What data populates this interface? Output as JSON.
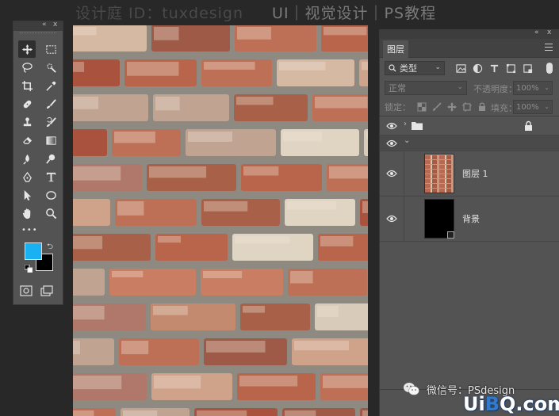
{
  "header": {
    "designer": "设计庭 ID：tuxdesign",
    "title": "UI｜视觉设计｜PS教程"
  },
  "tools": {
    "collapse": "«",
    "close": "x",
    "more": "•••",
    "foreground_color": "#19b1f2",
    "background_color": "#000000",
    "items": [
      {
        "name": "move-tool-icon",
        "active": true
      },
      {
        "name": "marquee-tool-icon"
      },
      {
        "name": "lasso-tool-icon"
      },
      {
        "name": "quick-select-tool-icon"
      },
      {
        "name": "crop-tool-icon"
      },
      {
        "name": "eyedropper-tool-icon"
      },
      {
        "name": "healing-brush-tool-icon"
      },
      {
        "name": "brush-tool-icon"
      },
      {
        "name": "clone-stamp-tool-icon"
      },
      {
        "name": "history-brush-tool-icon"
      },
      {
        "name": "eraser-tool-icon"
      },
      {
        "name": "gradient-tool-icon"
      },
      {
        "name": "blur-tool-icon"
      },
      {
        "name": "dodge-tool-icon"
      },
      {
        "name": "pen-tool-icon"
      },
      {
        "name": "type-tool-icon"
      },
      {
        "name": "path-select-tool-icon"
      },
      {
        "name": "ellipse-tool-icon"
      },
      {
        "name": "hand-tool-icon"
      },
      {
        "name": "zoom-tool-icon"
      }
    ]
  },
  "layers_panel": {
    "collapse": "«",
    "close": "x",
    "tab": "图层",
    "filter_kind": "类型",
    "blend_mode": "正常",
    "opacity_label": "不透明度：",
    "opacity_value": "100%",
    "lock_label": "锁定：",
    "fill_label": "填充：",
    "fill_value": "100%",
    "layers": [
      {
        "kind": "group",
        "name": "",
        "collapsed": true,
        "locked": true
      },
      {
        "kind": "group-open",
        "name": ""
      },
      {
        "kind": "layer",
        "name": "图层 1",
        "thumb": "bricks"
      },
      {
        "kind": "layer",
        "name": "背景",
        "thumb": "black"
      }
    ]
  },
  "watermarks": {
    "wechat": "微信号：PSdesign",
    "site_prefix": "Ui",
    "site_b": "B",
    "site_suffix": "Q.com"
  },
  "colors": {
    "app_bg": "#282828",
    "panel_bg": "#535353",
    "accent_blue": "#2e7bd1"
  }
}
